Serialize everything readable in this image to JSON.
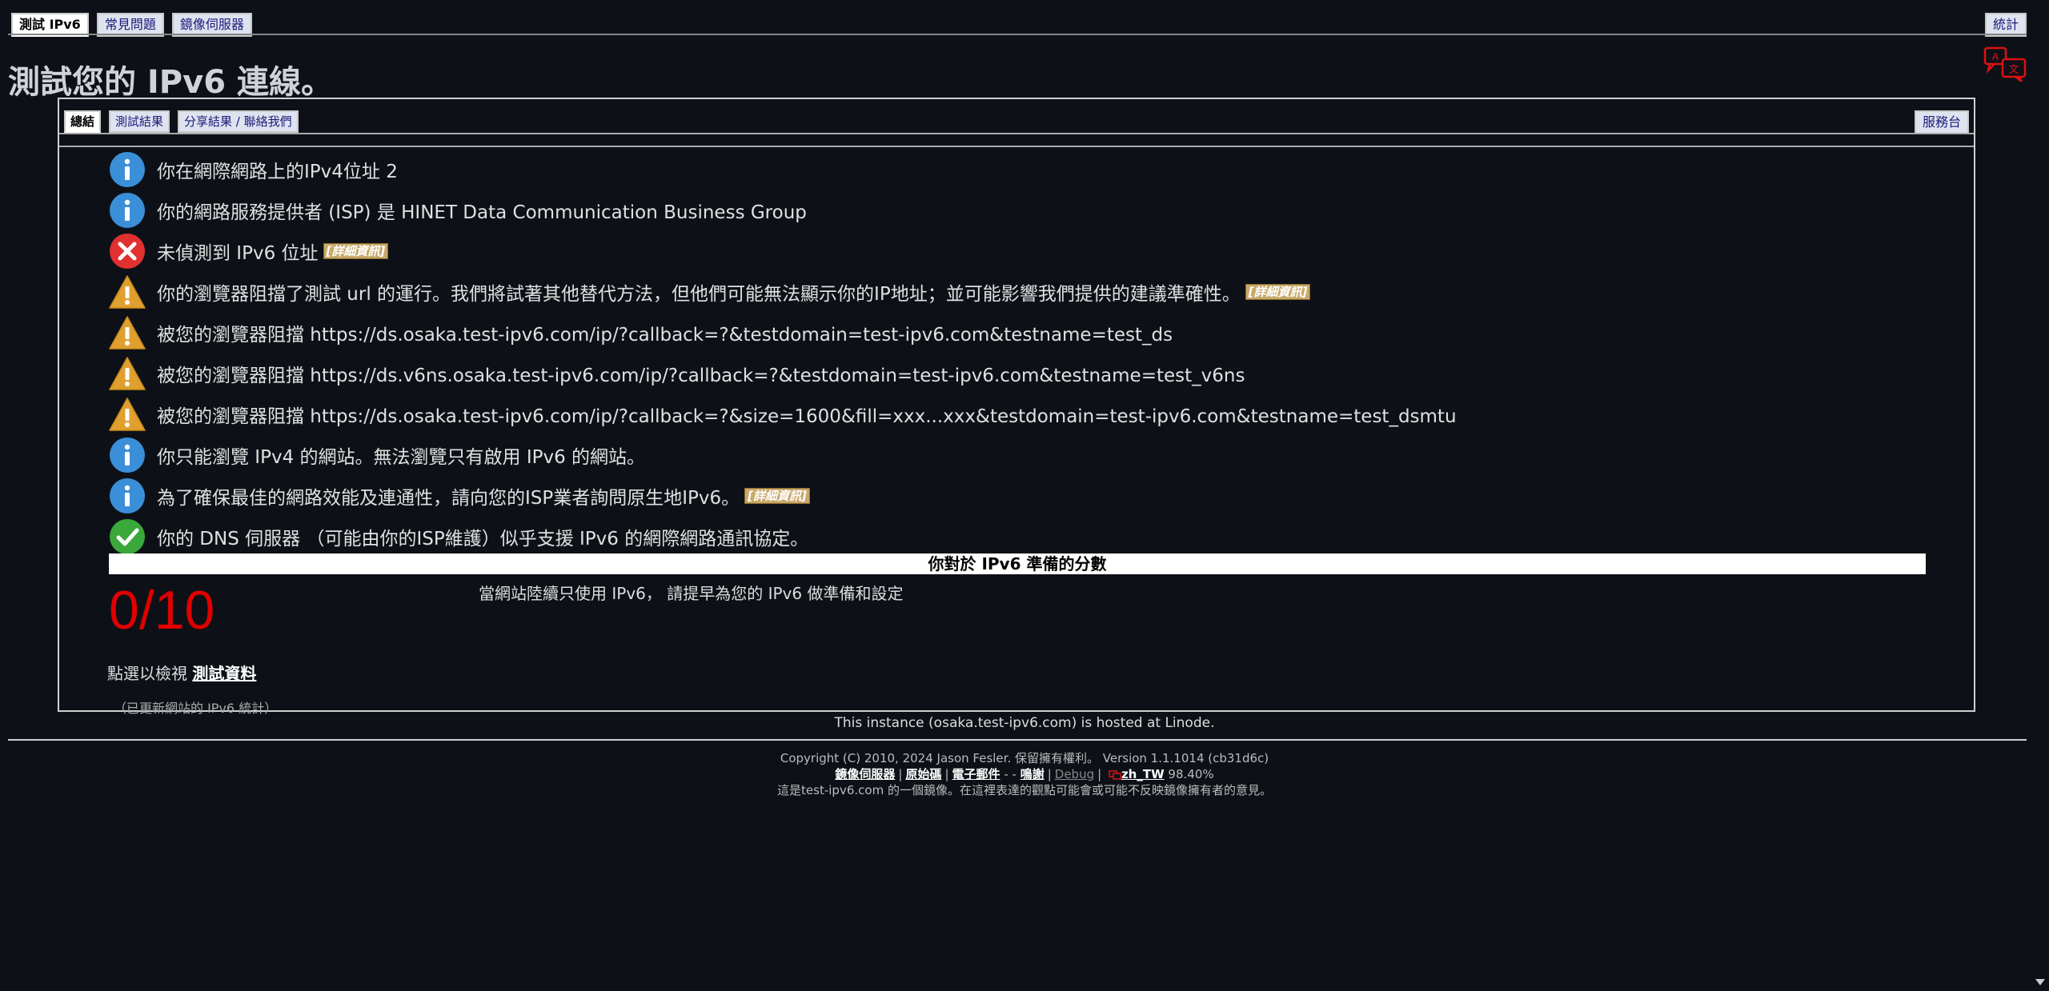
{
  "top_tabs": [
    "測試 IPv6",
    "常見問題",
    "鏡像伺服器"
  ],
  "stats_tab": "統計",
  "page_title": "測試您的 IPv6 連線。",
  "sub_tabs": [
    "總結",
    "測試結果",
    "分享結果 / 聯絡我們"
  ],
  "service_tab": "服務台",
  "more_label": "[詳細資訊]",
  "results": [
    {
      "icon": "info",
      "text": "你在網際網路上的IPv4位址 2"
    },
    {
      "icon": "info",
      "text": "你的網路服務提供者 (ISP) 是 HINET Data Communication Business Group"
    },
    {
      "icon": "error",
      "text": "未偵測到 IPv6 位址"
    },
    {
      "icon": "warning",
      "text": "你的瀏覽器阻擋了測試 url 的運行。我們將試著其他替代方法，但他們可能無法顯示你的IP地址；並可能影響我們提供的建議準確性。"
    },
    {
      "icon": "warning",
      "text": "被您的瀏覽器阻擋 https://ds.osaka.test-ipv6.com/ip/?callback=?&testdomain=test-ipv6.com&testname=test_ds"
    },
    {
      "icon": "warning",
      "text": "被您的瀏覽器阻擋 https://ds.v6ns.osaka.test-ipv6.com/ip/?callback=?&testdomain=test-ipv6.com&testname=test_v6ns"
    },
    {
      "icon": "warning",
      "text": "被您的瀏覽器阻擋 https://ds.osaka.test-ipv6.com/ip/?callback=?&size=1600&fill=xxx...xxx&testdomain=test-ipv6.com&testname=test_dsmtu"
    },
    {
      "icon": "info",
      "text": "你只能瀏覽 IPv4 的網站。無法瀏覽只有啟用 IPv6 的網站。"
    },
    {
      "icon": "info",
      "text": "為了確保最佳的網路效能及連通性，請向您的ISP業者詢問原生地IPv6。"
    },
    {
      "icon": "ok",
      "text": "你的 DNS 伺服器 （可能由你的ISP維護）似乎支援 IPv6 的網際網路通訊協定。"
    }
  ],
  "score_title": "你對於 IPv6 準備的分數",
  "score": "0/10",
  "score_message": "當網站陸續只使用 IPv6， 請提早為您的 IPv6 做準備和設定",
  "view_prefix": "點選以檢視",
  "view_link": "測試資料",
  "updated_note": "（已更新網站的 IPv6 統計）",
  "hosted": "This instance (osaka.test-ipv6.com) is hosted at Linode.",
  "copyright": "Copyright (C) 2010, 2024 Jason Fesler. 保留擁有權利。 Version 1.1.1014 (cb31d6c)",
  "footer_links": {
    "mirrors": "鏡像伺服器",
    "source": "原始碼",
    "email": "電子郵件",
    "dash": "-    -",
    "thanks": "鳴謝",
    "debug": "Debug",
    "locale": "zh_TW",
    "percent": "98.40%"
  },
  "disclaimer": "這是test-ipv6.com 的一個鏡像。在這裡表達的觀點可能會或可能不反映鏡像擁有者的意見。",
  "colors": {
    "bg": "#0d1117",
    "score": "#e00000",
    "info": "#3a8fd8",
    "error": "#e03030",
    "warning": "#e0a030",
    "ok": "#3aa83a"
  }
}
